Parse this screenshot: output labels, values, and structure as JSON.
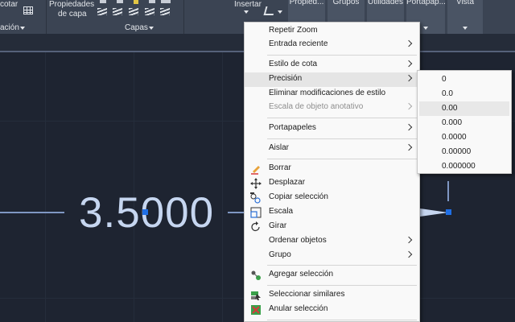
{
  "ribbon": {
    "acotar_label": "cotar",
    "anotacion_panel": "ación",
    "propiedades_capa_line1": "Propiedades",
    "propiedades_capa_line2": "de capa",
    "capas_panel": "Capas",
    "insertar_label": "Insertar",
    "propiedades_tab": "Propied...",
    "grupos_tab": "Grupos",
    "utilidades_tab": "Utilidades",
    "portapapeles_tab": "Portapap...",
    "vista_tab": "Vista"
  },
  "drawing": {
    "dimension_text": "3.5000"
  },
  "context_menu": {
    "items": [
      {
        "label": "Repetir Zoom",
        "submenu": false,
        "disabled": false,
        "icon": ""
      },
      {
        "label": "Entrada reciente",
        "submenu": true,
        "disabled": false,
        "icon": ""
      },
      {
        "label": "Estilo de cota",
        "submenu": true,
        "disabled": false,
        "icon": ""
      },
      {
        "label": "Precisión",
        "submenu": true,
        "disabled": false,
        "icon": "",
        "highlighted": true
      },
      {
        "label": "Eliminar modificaciones de estilo",
        "submenu": false,
        "disabled": false,
        "icon": ""
      },
      {
        "label": "Escala de objeto anotativo",
        "submenu": true,
        "disabled": true,
        "icon": ""
      },
      {
        "label": "Portapapeles",
        "submenu": true,
        "disabled": false,
        "icon": ""
      },
      {
        "label": "Aislar",
        "submenu": true,
        "disabled": false,
        "icon": ""
      },
      {
        "label": "Borrar",
        "submenu": false,
        "disabled": false,
        "icon": "eraser-icon"
      },
      {
        "label": "Desplazar",
        "submenu": false,
        "disabled": false,
        "icon": "move-icon"
      },
      {
        "label": "Copiar selección",
        "submenu": false,
        "disabled": false,
        "icon": "copy-icon"
      },
      {
        "label": "Escala",
        "submenu": false,
        "disabled": false,
        "icon": "scale-icon"
      },
      {
        "label": "Girar",
        "submenu": false,
        "disabled": false,
        "icon": "rotate-icon"
      },
      {
        "label": "Ordenar objetos",
        "submenu": true,
        "disabled": false,
        "icon": ""
      },
      {
        "label": "Grupo",
        "submenu": true,
        "disabled": false,
        "icon": ""
      },
      {
        "label": "Agregar selección",
        "submenu": false,
        "disabled": false,
        "icon": "add-selection-icon"
      },
      {
        "label": "Seleccionar similares",
        "submenu": false,
        "disabled": false,
        "icon": "select-similar-icon"
      },
      {
        "label": "Anular selección",
        "submenu": false,
        "disabled": false,
        "icon": "deselect-icon"
      }
    ]
  },
  "precision_submenu": {
    "options": [
      "0",
      "0.0",
      "0.00",
      "0.000",
      "0.0000",
      "0.00000",
      "0.000000"
    ],
    "highlighted": "0.00"
  },
  "colors": {
    "ribbon_bg": "#3b4453",
    "canvas_bg": "#1e2431",
    "dimension_line": "#7f97c3",
    "grip_blue": "#1f6fe6",
    "menu_bg": "#f9f9f9"
  }
}
